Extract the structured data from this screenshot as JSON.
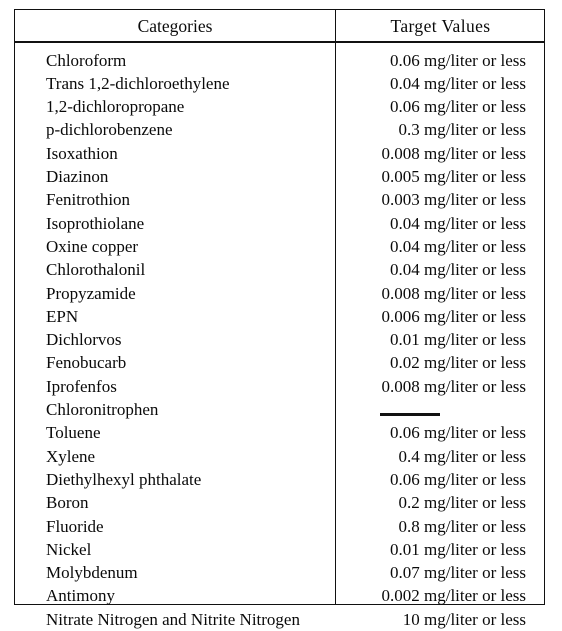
{
  "table": {
    "headers": {
      "categories": "Categories",
      "target_values": "Target Values"
    },
    "value_suffix": "mg/liter or less",
    "dash_placeholder": "—",
    "rows": [
      {
        "category": "Chloroform",
        "value": "0.06 mg/liter or less",
        "amount": "0.06",
        "unit": "mg/liter or less"
      },
      {
        "category": "Trans 1,2-dichloroethylene",
        "value": "0.04 mg/liter or less",
        "amount": "0.04",
        "unit": "mg/liter or less"
      },
      {
        "category": "1,2-dichloropropane",
        "value": "0.06 mg/liter or less",
        "amount": "0.06",
        "unit": "mg/liter or less"
      },
      {
        "category": "p-dichlorobenzene",
        "value": "0.3 mg/liter or less",
        "amount": "0.3",
        "unit": "mg/liter or less"
      },
      {
        "category": "Isoxathion",
        "value": "0.008 mg/liter or less",
        "amount": "0.008",
        "unit": "mg/liter or less"
      },
      {
        "category": "Diazinon",
        "value": "0.005 mg/liter or less",
        "amount": "0.005",
        "unit": "mg/liter or less"
      },
      {
        "category": "Fenitrothion",
        "value": "0.003 mg/liter or less",
        "amount": "0.003",
        "unit": "mg/liter or less"
      },
      {
        "category": "Isoprothiolane",
        "value": "0.04 mg/liter or less",
        "amount": "0.04",
        "unit": "mg/liter or less"
      },
      {
        "category": "Oxine copper",
        "value": "0.04 mg/liter or less",
        "amount": "0.04",
        "unit": "mg/liter or less"
      },
      {
        "category": "Chlorothalonil",
        "value": "0.04 mg/liter or less",
        "amount": "0.04",
        "unit": "mg/liter or less"
      },
      {
        "category": "Propyzamide",
        "value": "0.008 mg/liter or less",
        "amount": "0.008",
        "unit": "mg/liter or less"
      },
      {
        "category": "EPN",
        "value": "0.006 mg/liter or less",
        "amount": "0.006",
        "unit": "mg/liter or less"
      },
      {
        "category": "Dichlorvos",
        "value": "0.01 mg/liter or less",
        "amount": "0.01",
        "unit": "mg/liter or less"
      },
      {
        "category": "Fenobucarb",
        "value": "0.02 mg/liter or less",
        "amount": "0.02",
        "unit": "mg/liter or less"
      },
      {
        "category": "Iprofenfos",
        "value": "0.008 mg/liter or less",
        "amount": "0.008",
        "unit": "mg/liter or less"
      },
      {
        "category": "Chloronitrophen",
        "value": "—",
        "amount": "",
        "unit": ""
      },
      {
        "category": "Toluene",
        "value": "0.06 mg/liter or less",
        "amount": "0.06",
        "unit": "mg/liter or less"
      },
      {
        "category": "Xylene",
        "value": "0.4 mg/liter or less",
        "amount": "0.4",
        "unit": "mg/liter or less"
      },
      {
        "category": "Diethylhexyl phthalate",
        "value": "0.06 mg/liter or less",
        "amount": "0.06",
        "unit": "mg/liter or less"
      },
      {
        "category": "Boron",
        "value": "0.2 mg/liter or less",
        "amount": "0.2",
        "unit": "mg/liter or less"
      },
      {
        "category": "Fluoride",
        "value": "0.8 mg/liter or less",
        "amount": "0.8",
        "unit": "mg/liter or less"
      },
      {
        "category": "Nickel",
        "value": "0.01 mg/liter or less",
        "amount": "0.01",
        "unit": "mg/liter or less"
      },
      {
        "category": "Molybdenum",
        "value": "0.07 mg/liter or less",
        "amount": "0.07",
        "unit": "mg/liter or less"
      },
      {
        "category": "Antimony",
        "value": "0.002 mg/liter or less",
        "amount": "0.002",
        "unit": "mg/liter or less"
      },
      {
        "category": "Nitrate Nitrogen and Nitrite Nitrogen",
        "value": "10 mg/liter or less",
        "amount": "10",
        "unit": "mg/liter or less"
      }
    ]
  }
}
